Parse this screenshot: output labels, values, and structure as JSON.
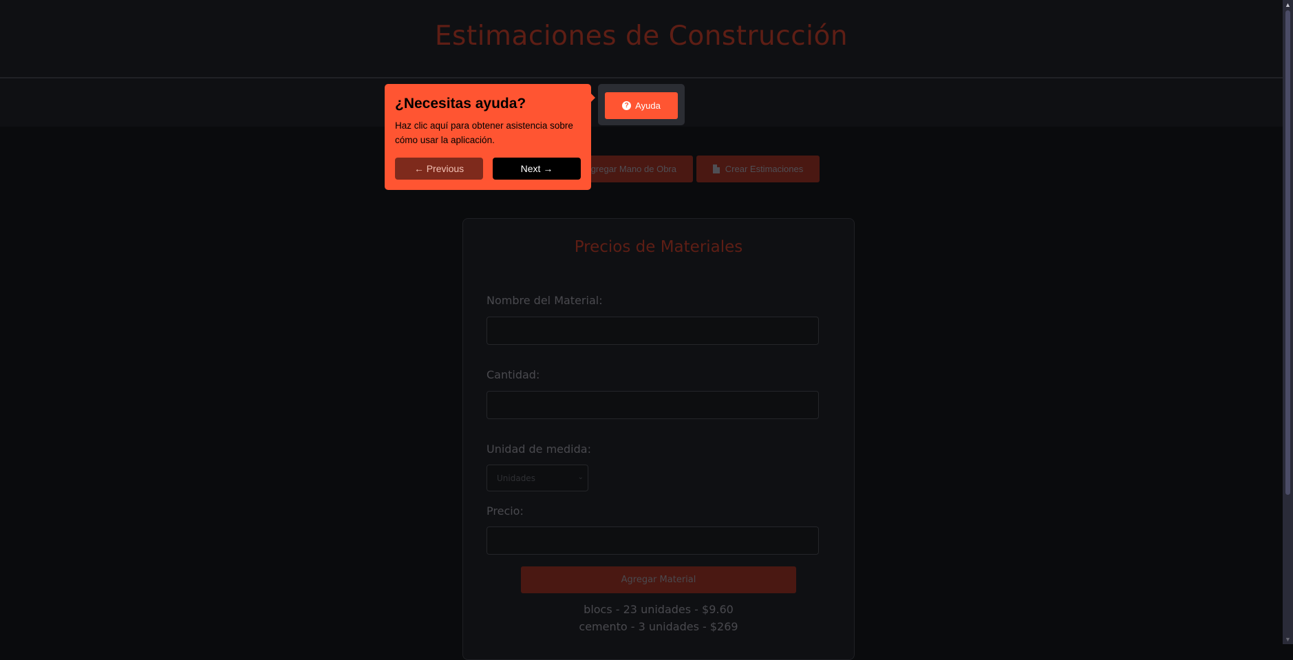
{
  "header": {
    "title": "Estimaciones de Construcción"
  },
  "help": {
    "button_label": "Ayuda",
    "icon": "question-circle-icon"
  },
  "nav": {
    "buttons": [
      {
        "label": "Agregar Mano de Obra"
      },
      {
        "label": "Crear Estimaciones",
        "icon": "file-invoice-icon"
      }
    ]
  },
  "card": {
    "title": "Precios de Materiales",
    "fields": {
      "name": {
        "label": "Nombre del Material:",
        "value": ""
      },
      "quantity": {
        "label": "Cantidad:",
        "value": ""
      },
      "unit": {
        "label": "Unidad de medida:",
        "selected": "Unidades"
      },
      "price": {
        "label": "Precio:",
        "value": ""
      }
    },
    "submit_label": "Agregar Material",
    "items": [
      "blocs - 23 unidades - $9.60",
      "cemento - 3 unidades - $269"
    ]
  },
  "tour": {
    "title": "¿Necesitas ayuda?",
    "body": "Haz clic aquí para obtener asistencia sobre cómo usar la aplicación.",
    "prev_label": "← Previous",
    "next_label": "Next →"
  },
  "colors": {
    "accent": "#ff5532",
    "background": "#0a0b0d",
    "panel": "#0f1013",
    "dim_accent": "#4a1812"
  }
}
